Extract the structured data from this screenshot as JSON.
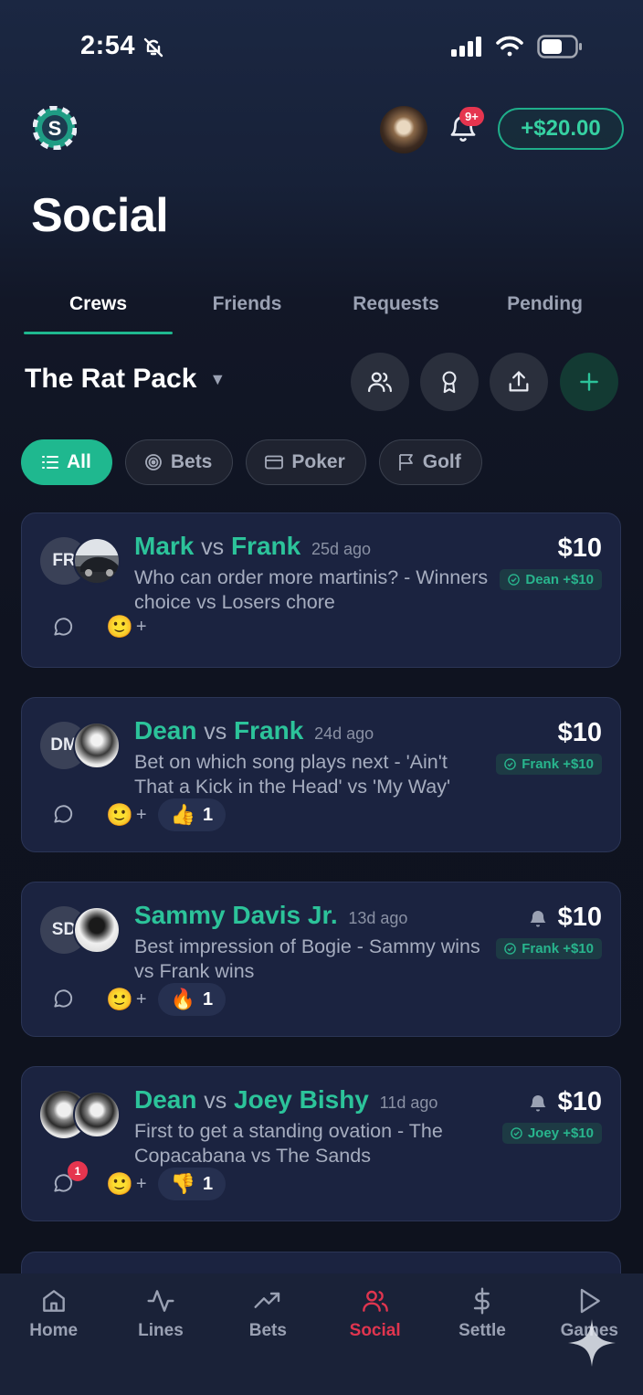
{
  "status_bar": {
    "time": "2:54"
  },
  "header": {
    "notification_badge": "9+",
    "balance": "+$20.00",
    "page_title": "Social"
  },
  "tabs": [
    {
      "label": "Crews",
      "active": true
    },
    {
      "label": "Friends",
      "active": false
    },
    {
      "label": "Requests",
      "active": false
    },
    {
      "label": "Pending",
      "active": false
    }
  ],
  "crew": {
    "name": "The Rat Pack"
  },
  "filters": [
    {
      "label": "All",
      "active": true
    },
    {
      "label": "Bets",
      "active": false
    },
    {
      "label": "Poker",
      "active": false
    },
    {
      "label": "Golf",
      "active": false
    }
  ],
  "cards": [
    {
      "initials": "FR",
      "name1": "Mark",
      "vs": "vs",
      "name2": "Frank",
      "ago": "25d ago",
      "desc": "Who can order more martinis? - Winners choice vs Losers chore",
      "amount": "$10",
      "bell": false,
      "winner": "Dean +$10",
      "reaction": null
    },
    {
      "initials": "DM",
      "name1": "Dean",
      "vs": "vs",
      "name2": "Frank",
      "ago": "24d ago",
      "desc": "Bet on which song plays next - 'Ain't That a Kick in the Head' vs 'My Way'",
      "amount": "$10",
      "bell": false,
      "winner": "Frank +$10",
      "reaction": {
        "emoji": "👍",
        "count": "1"
      }
    },
    {
      "initials": "SD",
      "name1": "Sammy Davis Jr.",
      "vs": "",
      "name2": "",
      "ago": "13d ago",
      "desc": "Best impression of Bogie - Sammy wins vs Frank wins",
      "amount": "$10",
      "bell": true,
      "winner": "Frank +$10",
      "reaction": {
        "emoji": "🔥",
        "count": "1"
      }
    },
    {
      "initials": "",
      "name1": "Dean",
      "vs": "vs",
      "name2": "Joey Bishy",
      "ago": "11d ago",
      "desc": "First to get a standing ovation - The Copacabana vs The Sands",
      "amount": "$10",
      "bell": true,
      "winner": "Joey +$10",
      "comment_badge": "1",
      "reaction": {
        "emoji": "👎",
        "count": "1"
      }
    }
  ],
  "bottom_nav": [
    {
      "label": "Home",
      "icon": "home-icon",
      "active": false
    },
    {
      "label": "Lines",
      "icon": "pulse-icon",
      "active": false
    },
    {
      "label": "Bets",
      "icon": "trend-icon",
      "active": false
    },
    {
      "label": "Social",
      "icon": "users-icon",
      "active": true
    },
    {
      "label": "Settle",
      "icon": "dollar-icon",
      "active": false
    },
    {
      "label": "Games",
      "icon": "play-icon",
      "active": false
    }
  ],
  "colors": {
    "accent": "#1fb88f",
    "active_nav": "#e0354f",
    "card_bg": "#1b2340"
  }
}
